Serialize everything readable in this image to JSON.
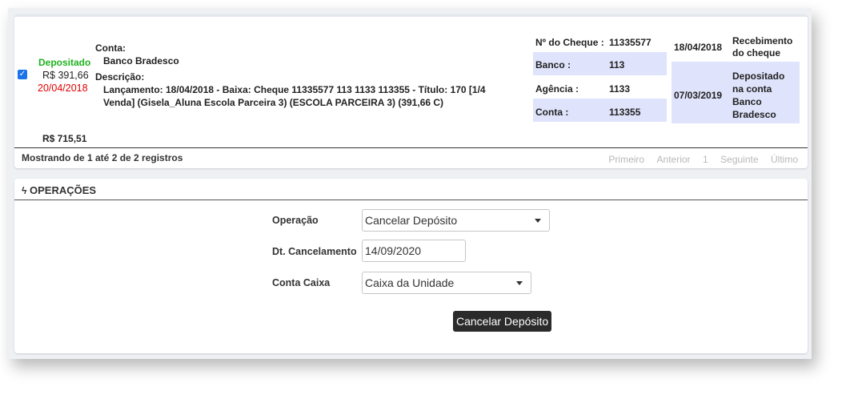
{
  "record": {
    "checked": true,
    "status": "Depositado",
    "amount": "R$ 391,66",
    "date": "20/04/2018",
    "conta_label": "Conta:",
    "conta_value": "Banco Bradesco",
    "descricao_label": "Descrição:",
    "descricao_line1": "Lançamento: 18/04/2018 - Baixa: Cheque 11335577 113 1133 113355 - Título: 170 [1/4",
    "descricao_line2": "Venda] (Gisela_Aluna Escola Parceira 3) (ESCOLA PARCEIRA 3) (391,66 C)",
    "cheque": {
      "numero_label": "Nº do Cheque :",
      "numero_value": "11335577",
      "banco_label": "Banco :",
      "banco_value": "113",
      "agencia_label": "Agência :",
      "agencia_value": "1133",
      "conta_label": "Conta :",
      "conta_value": "113355"
    },
    "history": [
      {
        "date": "18/04/2018",
        "event": "Recebimento do cheque"
      },
      {
        "date": "07/03/2019",
        "event": "Depositado na conta Banco Bradesco"
      }
    ]
  },
  "total": "R$ 715,51",
  "footer": {
    "showing": "Mostrando de 1 até 2 de 2 registros",
    "pager": {
      "first": "Primeiro",
      "prev": "Anterior",
      "page": "1",
      "next": "Seguinte",
      "last": "Último"
    }
  },
  "operations": {
    "title": "OPERAÇÕES",
    "operacao_label": "Operação",
    "operacao_value": "Cancelar Depósito",
    "dt_label": "Dt. Cancelamento",
    "dt_value": "14/09/2020",
    "conta_caixa_label": "Conta Caixa",
    "conta_caixa_value": "Caixa da Unidade",
    "submit_label": "Cancelar Depósito"
  },
  "colors": {
    "status_green": "#1db31d",
    "date_red": "#e00000",
    "shade": "#dfe3fb",
    "button": "#2b2b2b"
  }
}
